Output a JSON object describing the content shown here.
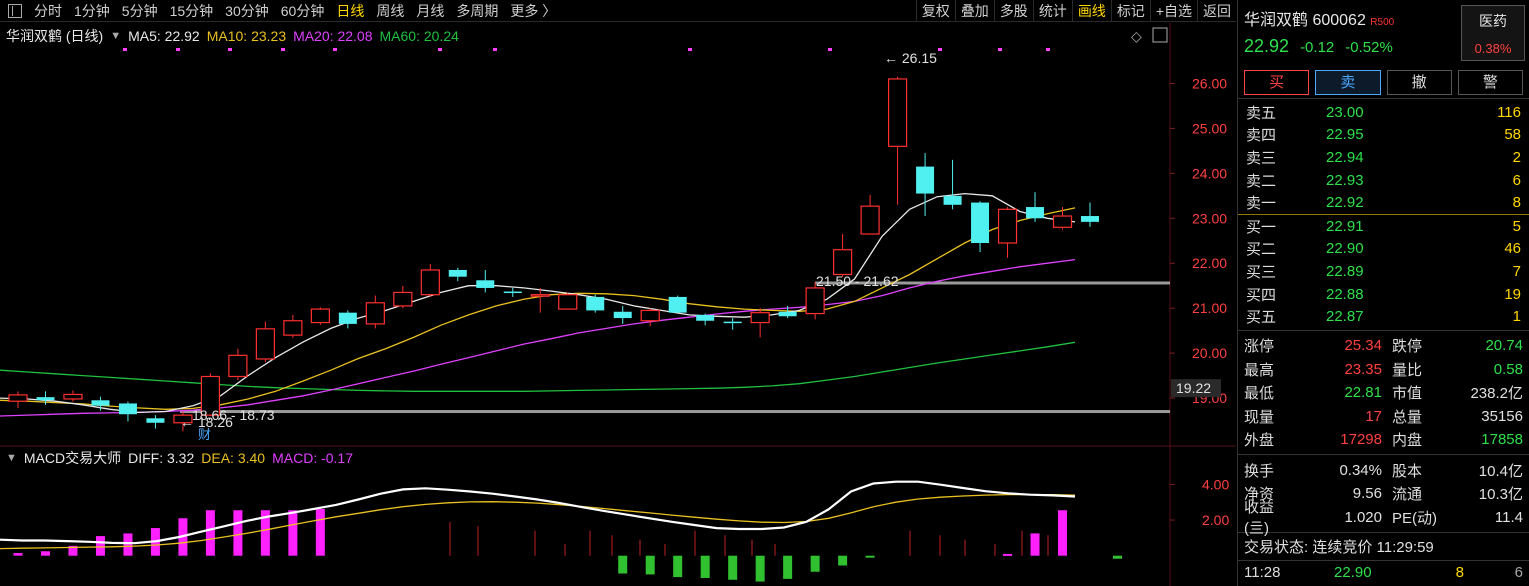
{
  "toolbar": {
    "periods": [
      "分时",
      "1分钟",
      "5分钟",
      "15分钟",
      "30分钟",
      "60分钟",
      "日线",
      "周线",
      "月线",
      "多周期",
      "更多 〉"
    ],
    "active_period": "日线",
    "actions": [
      "复权",
      "叠加",
      "多股",
      "统计",
      "画线",
      "标记",
      "+自选",
      "返回"
    ],
    "highlighted_action": "画线"
  },
  "legend": {
    "name": "华润双鹤 (日线)",
    "ma5": "MA5: 22.92",
    "ma10": "MA10: 23.23",
    "ma20": "MA20: 22.08",
    "ma60": "MA60: 20.24",
    "colors": {
      "ma5": "#e8e8e8",
      "ma10": "#e8c020",
      "ma20": "#e040ff",
      "ma60": "#20c040"
    }
  },
  "macd_legend": {
    "name": "MACD交易大师",
    "diff": "DIFF: 3.32",
    "dea": "DEA: 3.40",
    "macd": "MACD: -0.17"
  },
  "annotations": {
    "high": "26.15",
    "low": "18.26",
    "zone_low": "18.66 - 18.73",
    "zone_mid": "21.50 - 21.62",
    "current_price_tag": "19.22",
    "cai": "财"
  },
  "chart_data": {
    "type": "candlestick",
    "y_ticks": [
      "26.00",
      "25.00",
      "24.00",
      "23.00",
      "22.00",
      "21.00",
      "20.00",
      "19.00"
    ],
    "ylim": [
      18.0,
      26.9
    ],
    "candles": [
      {
        "o": 18.93,
        "c": 19.07,
        "h": 19.15,
        "l": 18.78
      },
      {
        "o": 19.02,
        "c": 18.95,
        "h": 19.15,
        "l": 18.85
      },
      {
        "o": 18.98,
        "c": 19.08,
        "h": 19.17,
        "l": 18.92
      },
      {
        "o": 18.95,
        "c": 18.83,
        "h": 19.03,
        "l": 18.72
      },
      {
        "o": 18.88,
        "c": 18.64,
        "h": 18.92,
        "l": 18.48
      },
      {
        "o": 18.55,
        "c": 18.45,
        "h": 18.62,
        "l": 18.32
      },
      {
        "o": 18.45,
        "c": 18.62,
        "h": 18.7,
        "l": 18.26
      },
      {
        "o": 18.62,
        "c": 19.48,
        "h": 19.55,
        "l": 18.6
      },
      {
        "o": 19.48,
        "c": 19.95,
        "h": 20.1,
        "l": 19.4
      },
      {
        "o": 19.87,
        "c": 20.54,
        "h": 20.7,
        "l": 19.8
      },
      {
        "o": 20.4,
        "c": 20.72,
        "h": 20.85,
        "l": 20.34
      },
      {
        "o": 20.68,
        "c": 20.98,
        "h": 21.02,
        "l": 20.63
      },
      {
        "o": 20.9,
        "c": 20.65,
        "h": 20.95,
        "l": 20.55
      },
      {
        "o": 20.65,
        "c": 21.12,
        "h": 21.28,
        "l": 20.55
      },
      {
        "o": 21.05,
        "c": 21.35,
        "h": 21.5,
        "l": 21.0
      },
      {
        "o": 21.3,
        "c": 21.85,
        "h": 21.98,
        "l": 21.25
      },
      {
        "o": 21.85,
        "c": 21.7,
        "h": 21.9,
        "l": 21.6
      },
      {
        "o": 21.62,
        "c": 21.45,
        "h": 21.85,
        "l": 21.35
      },
      {
        "o": 21.37,
        "c": 21.35,
        "h": 21.45,
        "l": 21.25
      },
      {
        "o": 21.3,
        "c": 21.3,
        "h": 21.45,
        "l": 20.9
      },
      {
        "o": 20.98,
        "c": 21.3,
        "h": 21.35,
        "l": 20.98
      },
      {
        "o": 21.25,
        "c": 20.95,
        "h": 21.3,
        "l": 20.9
      },
      {
        "o": 20.92,
        "c": 20.78,
        "h": 21.05,
        "l": 20.65
      },
      {
        "o": 20.72,
        "c": 20.95,
        "h": 21.0,
        "l": 20.6
      },
      {
        "o": 21.25,
        "c": 20.9,
        "h": 21.28,
        "l": 20.9
      },
      {
        "o": 20.85,
        "c": 20.72,
        "h": 20.88,
        "l": 20.62
      },
      {
        "o": 20.7,
        "c": 20.68,
        "h": 20.78,
        "l": 20.52
      },
      {
        "o": 20.68,
        "c": 20.9,
        "h": 21.0,
        "l": 20.35
      },
      {
        "o": 20.92,
        "c": 20.82,
        "h": 21.05,
        "l": 20.78
      },
      {
        "o": 20.88,
        "c": 21.45,
        "h": 21.58,
        "l": 20.75
      },
      {
        "o": 21.75,
        "c": 22.3,
        "h": 22.65,
        "l": 21.7
      },
      {
        "o": 22.65,
        "c": 23.27,
        "h": 23.52,
        "l": 22.75
      },
      {
        "o": 24.6,
        "c": 26.1,
        "h": 26.15,
        "l": 23.3
      },
      {
        "o": 24.15,
        "c": 23.55,
        "h": 24.45,
        "l": 23.05
      },
      {
        "o": 23.5,
        "c": 23.3,
        "h": 24.3,
        "l": 23.2
      },
      {
        "o": 23.35,
        "c": 22.45,
        "h": 23.38,
        "l": 22.25
      },
      {
        "o": 22.45,
        "c": 23.2,
        "h": 23.25,
        "l": 22.12
      },
      {
        "o": 23.25,
        "c": 23.0,
        "h": 23.58,
        "l": 22.92
      },
      {
        "o": 22.8,
        "c": 23.05,
        "h": 23.25,
        "l": 22.75
      },
      {
        "o": 23.05,
        "c": 22.92,
        "h": 23.35,
        "l": 22.81
      }
    ],
    "ma5": [
      19.0,
      18.98,
      18.93,
      18.85,
      18.75,
      18.68,
      18.7,
      18.83,
      19.05,
      19.5,
      19.9,
      20.25,
      20.55,
      20.78,
      20.95,
      21.15,
      21.35,
      21.5,
      21.5,
      21.45,
      21.38,
      21.3,
      21.2,
      21.05,
      20.95,
      20.85,
      20.82,
      20.8,
      20.85,
      20.95,
      21.2,
      21.65,
      22.6,
      23.2,
      23.48,
      23.55,
      23.5,
      23.15,
      23.0,
      22.92
    ],
    "ma10": [
      18.95,
      18.93,
      18.9,
      18.87,
      18.82,
      18.78,
      18.75,
      18.77,
      18.85,
      18.98,
      19.15,
      19.38,
      19.62,
      19.88,
      20.1,
      20.35,
      20.62,
      20.85,
      21.05,
      21.2,
      21.3,
      21.33,
      21.32,
      21.28,
      21.2,
      21.1,
      21.03,
      20.98,
      20.95,
      20.93,
      20.98,
      21.15,
      21.45,
      21.75,
      22.1,
      22.45,
      22.75,
      22.95,
      23.1,
      23.23
    ],
    "ma20": [
      18.6,
      18.62,
      18.64,
      18.66,
      18.67,
      18.68,
      18.7,
      18.73,
      18.78,
      18.85,
      18.95,
      19.05,
      19.18,
      19.32,
      19.46,
      19.6,
      19.75,
      19.9,
      20.05,
      20.2,
      20.32,
      20.45,
      20.55,
      20.65,
      20.73,
      20.8,
      20.87,
      20.93,
      20.98,
      21.02,
      21.08,
      21.15,
      21.28,
      21.45,
      21.6,
      21.72,
      21.82,
      21.92,
      22.0,
      22.08
    ],
    "ma60": [
      19.62,
      19.58,
      19.54,
      19.5,
      19.46,
      19.42,
      19.38,
      19.34,
      19.3,
      19.26,
      19.23,
      19.21,
      19.19,
      19.17,
      19.16,
      19.15,
      19.15,
      19.15,
      19.15,
      19.15,
      19.16,
      19.17,
      19.18,
      19.19,
      19.2,
      19.21,
      19.22,
      19.24,
      19.27,
      19.32,
      19.4,
      19.48,
      19.58,
      19.68,
      19.78,
      19.87,
      19.96,
      20.05,
      20.14,
      20.24
    ],
    "macd": {
      "y_ticks": [
        "4.00",
        "2.00"
      ],
      "ylim": [
        -1.7,
        5.2
      ],
      "diff": [
        0.9,
        0.85,
        0.85,
        0.82,
        0.78,
        0.72,
        0.7,
        0.82,
        1.05,
        1.35,
        1.65,
        1.95,
        2.2,
        2.4,
        2.62,
        2.85,
        3.15,
        3.48,
        3.72,
        3.78,
        3.7,
        3.6,
        3.48,
        3.32,
        3.15,
        2.95,
        2.72,
        2.5,
        2.3,
        2.1,
        1.9,
        1.72,
        1.55,
        1.5,
        1.5,
        1.58,
        1.9,
        2.6,
        3.6,
        4.05,
        4.15,
        4.15,
        3.98,
        3.8,
        3.62,
        3.5,
        3.42,
        3.38,
        3.32
      ],
      "dea": [
        0.4,
        0.42,
        0.44,
        0.46,
        0.48,
        0.5,
        0.54,
        0.6,
        0.7,
        0.85,
        1.05,
        1.25,
        1.48,
        1.72,
        1.95,
        2.18,
        2.38,
        2.58,
        2.75,
        2.88,
        2.97,
        3.02,
        3.03,
        3.0,
        2.95,
        2.86,
        2.76,
        2.64,
        2.52,
        2.4,
        2.28,
        2.16,
        2.05,
        1.95,
        1.88,
        1.86,
        1.92,
        2.1,
        2.4,
        2.75,
        3.0,
        3.18,
        3.28,
        3.35,
        3.4,
        3.43,
        3.43,
        3.42,
        3.4
      ],
      "bars": [
        0.15,
        0.25,
        0.55,
        1.1,
        1.25,
        1.55,
        2.1,
        2.55,
        2.55,
        2.55,
        2.55,
        2.62,
        0.0,
        0.0,
        0.0,
        0.0,
        0.0,
        0.0,
        0.0,
        0.0,
        0.0,
        0.0,
        -1.0,
        -1.05,
        -1.2,
        -1.25,
        -1.35,
        -1.45,
        -1.3,
        -0.9,
        -0.55,
        -0.1,
        0.0,
        0.0,
        0.0,
        0.0,
        0.1,
        1.25,
        2.55,
        0.0,
        -0.17
      ]
    }
  },
  "panel": {
    "name": "华润双鹤 600062",
    "r_tag": "R500",
    "industry": "医药",
    "industry_change": "0.38%",
    "price": "22.92",
    "change": "-0.12",
    "change_pct": "-0.52%",
    "buttons": [
      "买",
      "卖",
      "撤",
      "警"
    ],
    "asks": [
      {
        "label": "卖五",
        "price": "23.00",
        "vol": "116"
      },
      {
        "label": "卖四",
        "price": "22.95",
        "vol": "58"
      },
      {
        "label": "卖三",
        "price": "22.94",
        "vol": "2"
      },
      {
        "label": "卖二",
        "price": "22.93",
        "vol": "6"
      },
      {
        "label": "卖一",
        "price": "22.92",
        "vol": "8"
      }
    ],
    "bids": [
      {
        "label": "买一",
        "price": "22.91",
        "vol": "5"
      },
      {
        "label": "买二",
        "price": "22.90",
        "vol": "46"
      },
      {
        "label": "买三",
        "price": "22.89",
        "vol": "7"
      },
      {
        "label": "买四",
        "price": "22.88",
        "vol": "19"
      },
      {
        "label": "买五",
        "price": "22.87",
        "vol": "1"
      }
    ],
    "stats1": [
      {
        "k": "涨停",
        "v": "25.34",
        "vc": "red",
        "k2": "跌停",
        "v2": "20.74",
        "v2c": "green"
      },
      {
        "k": "最高",
        "v": "23.35",
        "vc": "red",
        "k2": "量比",
        "v2": "0.58",
        "v2c": "green"
      },
      {
        "k": "最低",
        "v": "22.81",
        "vc": "green",
        "k2": "市值",
        "v2": "238.2亿",
        "v2c": "white"
      },
      {
        "k": "现量",
        "v": "17",
        "vc": "red",
        "k2": "总量",
        "v2": "35156",
        "v2c": "white"
      },
      {
        "k": "外盘",
        "v": "17298",
        "vc": "red",
        "k2": "内盘",
        "v2": "17858",
        "v2c": "green"
      }
    ],
    "stats2": [
      {
        "k": "换手",
        "v": "0.34%",
        "vc": "white",
        "k2": "股本",
        "v2": "10.4亿",
        "v2c": "white"
      },
      {
        "k": "净资",
        "v": "9.56",
        "vc": "white",
        "k2": "流通",
        "v2": "10.3亿",
        "v2c": "white"
      },
      {
        "k": "收益(亖)",
        "v": "1.020",
        "vc": "white",
        "k2": "PE(动)",
        "v2": "11.4",
        "v2c": "white"
      }
    ],
    "status": "交易状态: 连续竞价 11:29:59",
    "trade": {
      "time": "11:28",
      "price": "22.90",
      "qty": "8",
      "n": "6"
    }
  }
}
